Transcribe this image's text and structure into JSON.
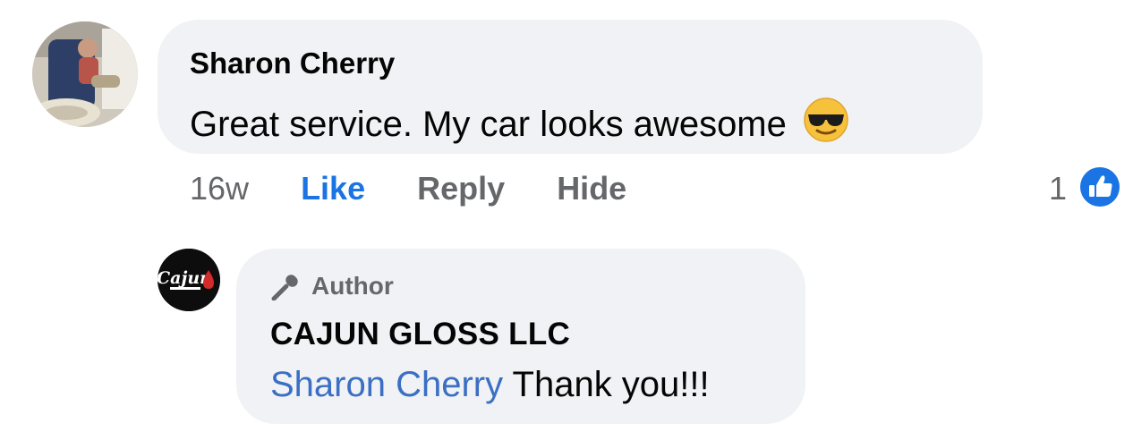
{
  "comment": {
    "author": "Sharon Cherry",
    "text": "Great service.  My car looks awesome",
    "emoji": "smiling-face-with-sunglasses",
    "timestamp": "16w",
    "actions": {
      "like": "Like",
      "reply": "Reply",
      "hide": "Hide"
    },
    "reaction_count": "1"
  },
  "reply": {
    "badge": "Author",
    "author": "CAJUN GLOSS LLC",
    "mention": "Sharon Cherry",
    "text": " Thank you!!!",
    "logo_text": "Cajun"
  },
  "colors": {
    "bubble": "#f0f2f5",
    "link": "#1b74e4",
    "muted": "#65676b",
    "text": "#050505"
  }
}
